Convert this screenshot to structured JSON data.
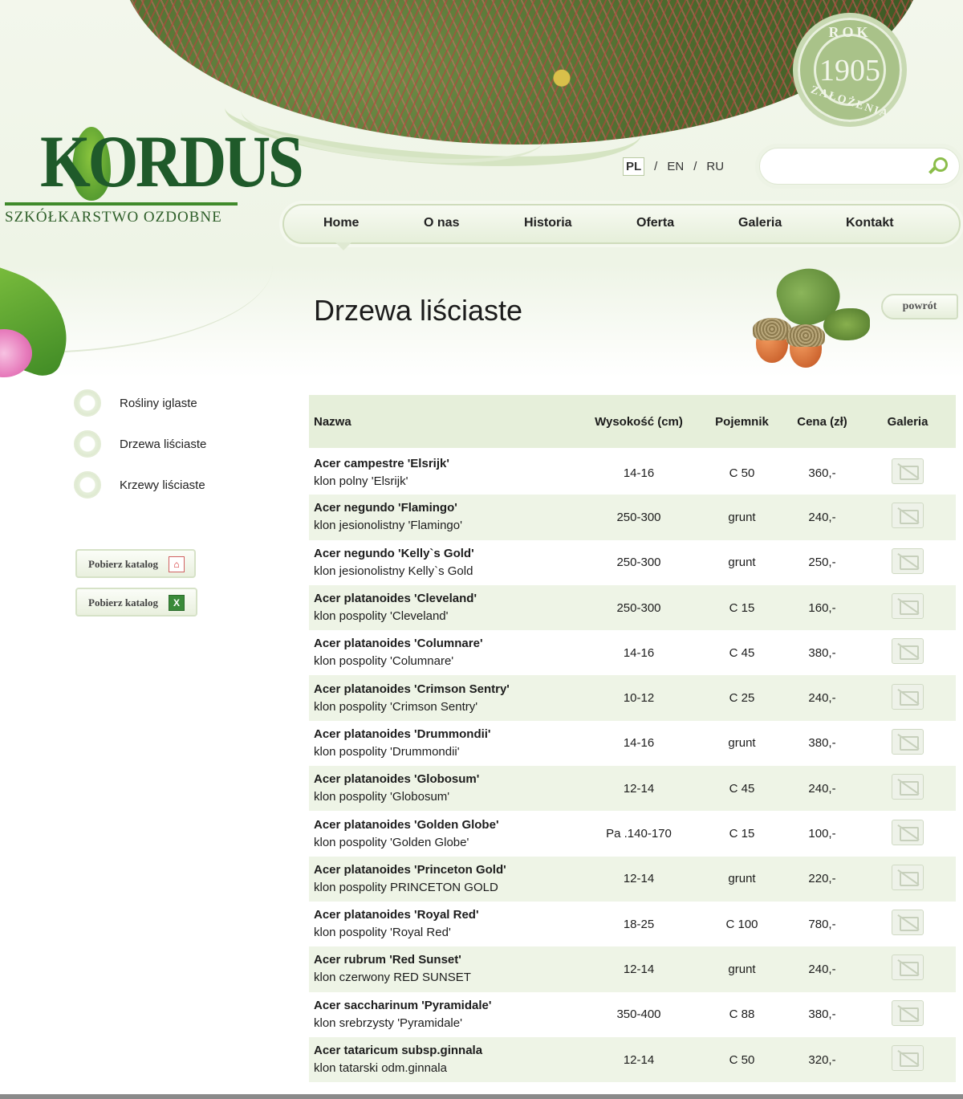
{
  "brand": {
    "logo_text": "KORDUS",
    "logo_subtitle": "SZKÓŁKARSTWO OZDOBNE",
    "seal_top": "ROK",
    "seal_year": "1905",
    "seal_bottom": "ZAŁOŻENIA"
  },
  "languages": {
    "active": "PL",
    "items": [
      "PL",
      "EN",
      "RU"
    ],
    "separator": "/"
  },
  "search": {
    "placeholder": "",
    "value": ""
  },
  "nav": {
    "items": [
      "Home",
      "O nas",
      "Historia",
      "Oferta",
      "Galeria",
      "Kontakt"
    ],
    "active": "Home"
  },
  "page": {
    "title": "Drzewa liściaste",
    "back_label": "powrót"
  },
  "sidebar": {
    "items": [
      "Rośliny iglaste",
      "Drzewa liściaste",
      "Krzewy liściaste"
    ],
    "downloads": [
      {
        "label": "Pobierz katalog",
        "icon": "pdf-icon"
      },
      {
        "label": "Pobierz katalog",
        "icon": "excel-icon"
      }
    ]
  },
  "table": {
    "headers": [
      "Nazwa",
      "Wysokość (cm)",
      "Pojemnik",
      "Cena (zł)",
      "Galeria"
    ],
    "rows": [
      {
        "latin": "Acer campestre 'Elsrijk'",
        "common": "klon polny 'Elsrijk'",
        "height": "14-16",
        "container": "C 50",
        "price": "360,-"
      },
      {
        "latin": "Acer negundo 'Flamingo'",
        "common": "klon jesionolistny 'Flamingo'",
        "height": "250-300",
        "container": "grunt",
        "price": "240,-"
      },
      {
        "latin": "Acer negundo 'Kelly`s Gold'",
        "common": "klon jesionolistny Kelly`s Gold",
        "height": "250-300",
        "container": "grunt",
        "price": "250,-"
      },
      {
        "latin": "Acer platanoides 'Cleveland'",
        "common": "klon pospolity 'Cleveland'",
        "height": "250-300",
        "container": "C 15",
        "price": "160,-"
      },
      {
        "latin": "Acer platanoides 'Columnare'",
        "common": "klon pospolity 'Columnare'",
        "height": "14-16",
        "container": "C 45",
        "price": "380,-"
      },
      {
        "latin": "Acer platanoides 'Crimson Sentry'",
        "common": "klon pospolity 'Crimson Sentry'",
        "height": "10-12",
        "container": "C 25",
        "price": "240,-"
      },
      {
        "latin": "Acer platanoides 'Drummondii'",
        "common": "klon pospolity 'Drummondii'",
        "height": "14-16",
        "container": "grunt",
        "price": "380,-"
      },
      {
        "latin": "Acer platanoides 'Globosum'",
        "common": "klon pospolity 'Globosum'",
        "height": "12-14",
        "container": "C 45",
        "price": "240,-"
      },
      {
        "latin": "Acer platanoides 'Golden Globe'",
        "common": "klon pospolity 'Golden Globe'",
        "height": "Pa .140-170",
        "container": "C 15",
        "price": "100,-"
      },
      {
        "latin": "Acer platanoides 'Princeton Gold'",
        "common": "klon pospolity PRINCETON GOLD",
        "height": "12-14",
        "container": "grunt",
        "price": "220,-"
      },
      {
        "latin": "Acer platanoides 'Royal Red'",
        "common": "klon pospolity 'Royal Red'",
        "height": "18-25",
        "container": "C 100",
        "price": "780,-"
      },
      {
        "latin": "Acer rubrum 'Red Sunset'",
        "common": "klon czerwony RED SUNSET",
        "height": "12-14",
        "container": "grunt",
        "price": "240,-"
      },
      {
        "latin": "Acer saccharinum 'Pyramidale'",
        "common": "klon srebrzysty 'Pyramidale'",
        "height": "350-400",
        "container": "C 88",
        "price": "380,-"
      },
      {
        "latin": "Acer tataricum subsp.ginnala",
        "common": "klon tatarski odm.ginnala",
        "height": "12-14",
        "container": "C 50",
        "price": "320,-"
      }
    ]
  },
  "colors": {
    "brand_green": "#1f5a2a",
    "accent_green": "#8bbd4a",
    "row_alt": "#eef4e6",
    "header_bg": "#e6efda"
  }
}
